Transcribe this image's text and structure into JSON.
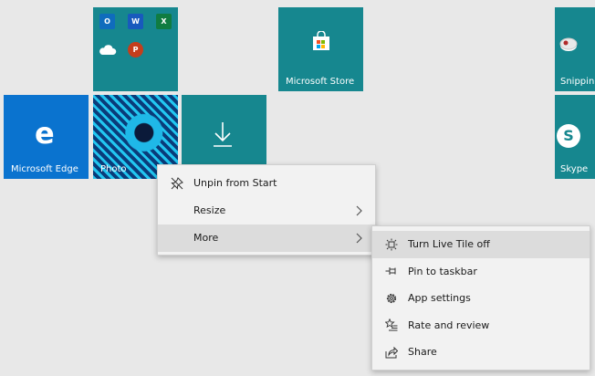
{
  "tiles": {
    "store": {
      "label": "Microsoft Store"
    },
    "edge": {
      "label": "Microsoft Edge"
    },
    "photos": {
      "label": "Photo"
    },
    "snipping": {
      "label": "Snippin"
    },
    "skype": {
      "label": "Skype"
    },
    "office_group": {
      "apps": [
        {
          "letter": "O",
          "color": "#0f6cbd"
        },
        {
          "letter": "W",
          "color": "#185abd"
        },
        {
          "letter": "X",
          "color": "#107c41"
        },
        {
          "letter": "",
          "color": "#0f6cbd"
        },
        {
          "letter": "P",
          "color": "#c43e1c"
        }
      ]
    }
  },
  "context_menu": {
    "items": [
      {
        "label": "Unpin from Start",
        "icon": "unpin-icon"
      },
      {
        "label": "Resize",
        "icon": ""
      },
      {
        "label": "More",
        "icon": ""
      }
    ]
  },
  "more_submenu": {
    "items": [
      {
        "label": "Turn Live Tile off",
        "icon": "live-tile-icon"
      },
      {
        "label": "Pin to taskbar",
        "icon": "pin-icon"
      },
      {
        "label": "App settings",
        "icon": "gear-icon"
      },
      {
        "label": "Rate and review",
        "icon": "rate-icon"
      },
      {
        "label": "Share",
        "icon": "share-icon"
      }
    ]
  },
  "colors": {
    "tile_teal": "#16878f",
    "tile_edge_blue": "#0a73cf",
    "desktop_bg": "#e8e8e8",
    "menu_bg": "#f2f2f2",
    "menu_highlight": "#dcdcdc"
  }
}
